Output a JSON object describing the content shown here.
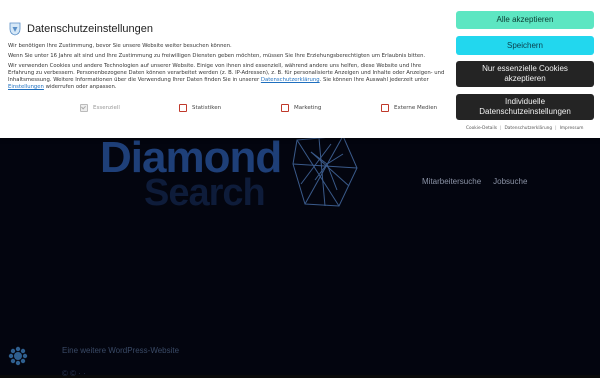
{
  "site": {
    "logo_line1": "Diamond",
    "logo_line2": "Search",
    "nav": [
      "Mitarbeitersuche",
      "Jobsuche"
    ],
    "tagline": "Eine weitere WordPress-Website",
    "bottom_text": "© © · ·"
  },
  "banner": {
    "title": "Datenschutzeinstellungen",
    "p1": "Wir benötigen Ihre Zustimmung, bevor Sie unsere Website weiter besuchen können.",
    "p2": "Wenn Sie unter 16 Jahre alt sind und Ihre Zustimmung zu freiwilligen Diensten geben möchten, müssen Sie Ihre Erziehungsberechtigten um Erlaubnis bitten.",
    "p3_a": "Wir verwenden Cookies und andere Technologien auf unserer Website. Einige von ihnen sind essenziell, während andere uns helfen, diese Website und Ihre Erfahrung zu verbessern. Personenbezogene Daten können verarbeitet werden (z. B. IP-Adressen), z. B. für personalisierte Anzeigen und Inhalte oder Anzeigen- und Inhaltsmessung. Weitere Informationen über die Verwendung Ihrer Daten finden Sie in unserer",
    "p3_link1": "Datenschutzerklärung",
    "p3_b": ". Sie können Ihre Auswahl jederzeit unter",
    "p3_link2": "Einstellungen",
    "p3_c": "widerrufen oder anpassen.",
    "checkboxes": [
      {
        "label": "Essenziell",
        "checked": true,
        "disabled": true
      },
      {
        "label": "Statistiken",
        "checked": false,
        "disabled": false
      },
      {
        "label": "Marketing",
        "checked": false,
        "disabled": false
      },
      {
        "label": "Externe Medien",
        "checked": false,
        "disabled": false
      }
    ],
    "buttons": {
      "accept_all": "Alle akzeptieren",
      "save": "Speichern",
      "essential_only": "Nur essenzielle Cookies akzeptieren",
      "individual": "Individuelle Datenschutzeinstellungen"
    },
    "footer_links": [
      "Cookie-Details",
      "Datenschutzerklärung",
      "Impressum"
    ]
  },
  "colors": {
    "accept_bg": "#5de6c2",
    "save_bg": "#22d7ee",
    "dark_button_bg": "#242424",
    "page_bg": "#03050f",
    "logo_blue": "#1e3f78"
  },
  "icons": {
    "banner_icon": "shield-diamond-icon",
    "privacy_fab": "privacy-settings-icon",
    "logo_gem": "diamond-gem-icon"
  }
}
